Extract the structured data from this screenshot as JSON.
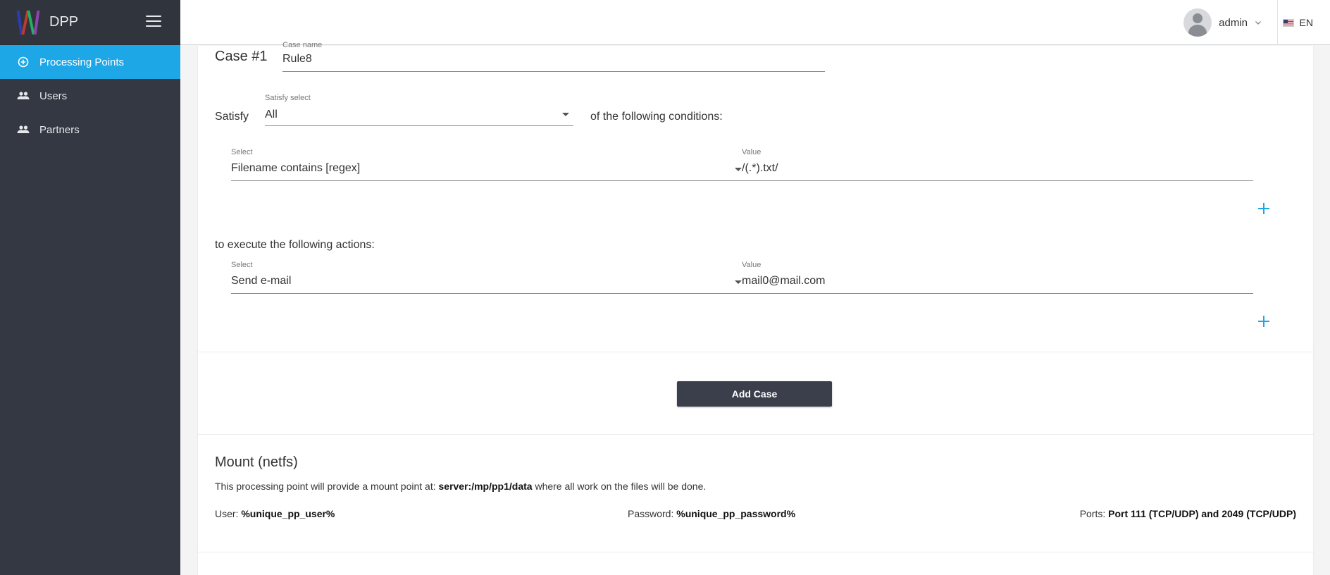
{
  "app": {
    "brand_name": "DPP",
    "accent": "#1ea7e7",
    "sidebar_bg": "#333842"
  },
  "sidebar": {
    "items": [
      {
        "label": "Processing Points",
        "icon": "plus-circle-icon",
        "active": true
      },
      {
        "label": "Users",
        "icon": "people-icon",
        "active": false
      },
      {
        "label": "Partners",
        "icon": "people-icon",
        "active": false
      }
    ]
  },
  "topbar": {
    "user_name": "admin",
    "language": "EN"
  },
  "case": {
    "title": "Case #1",
    "name_label": "Case name",
    "name_value": "Rule8",
    "satisfy_prefix": "Satisfy",
    "satisfy_label": "Satisfy select",
    "satisfy_value": "All",
    "satisfy_suffix": "of the following conditions:",
    "condition": {
      "select_label": "Select",
      "select_value": "Filename contains [regex]",
      "value_label": "Value",
      "value_value": "/(.*).txt/"
    },
    "actions_intro": "to execute the following actions:",
    "action": {
      "select_label": "Select",
      "select_value": "Send e-mail",
      "value_label": "Value",
      "value_value": "mail0@mail.com"
    },
    "add_case_label": "Add Case"
  },
  "mount": {
    "title": "Mount (netfs)",
    "desc_prefix": "This processing point will provide a mount point at: ",
    "desc_path": "server:/mp/pp1/data",
    "desc_suffix": " where all work on the files will be done.",
    "user_label": "User: ",
    "user_value": "%unique_pp_user%",
    "password_label": "Password: ",
    "password_value": "%unique_pp_password%",
    "ports_label": "Ports: ",
    "ports_value": "Port 111 (TCP/UDP) and 2049 (TCP/UDP)"
  }
}
